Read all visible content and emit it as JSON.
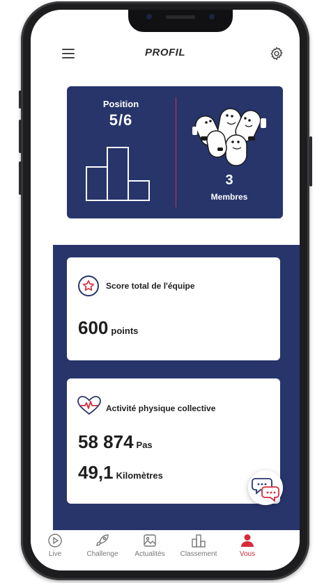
{
  "header": {
    "title": "PROFIL"
  },
  "team": {
    "position_label": "Position",
    "position_value": "5/6",
    "members_count": "3",
    "members_label": "Membres"
  },
  "score_card": {
    "title": "Score total de l'équipe",
    "value": "600",
    "unit": "points"
  },
  "activity_card": {
    "title": "Activité physique collective",
    "steps_value": "58 874",
    "steps_unit": "Pas",
    "distance_value": "49,1",
    "distance_unit": "Kilomètres"
  },
  "bottom_nav": {
    "items": [
      {
        "label": "Live",
        "icon": "play-icon"
      },
      {
        "label": "Challenge",
        "icon": "rocket-icon"
      },
      {
        "label": "Actualités",
        "icon": "image-icon"
      },
      {
        "label": "Classement",
        "icon": "podium-icon"
      },
      {
        "label": "Vous",
        "icon": "person-icon",
        "active": true
      }
    ]
  },
  "colors": {
    "navy": "#27356b",
    "accent_red": "#d62b3a"
  }
}
